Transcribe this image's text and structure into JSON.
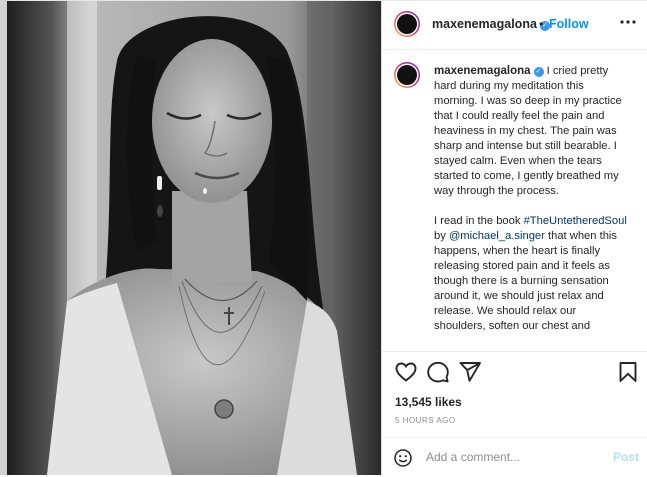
{
  "post": {
    "username": "maxenemagalona",
    "separator": "•",
    "follow_label": "Follow",
    "more_icon": "more-horizontal-icon",
    "verified_icon": "verified-badge-icon",
    "verified_glyph": "✓",
    "image_alt": "Black and white photo of a woman with eyes closed and a tear on her cheek"
  },
  "caption": {
    "username": "maxenemagalona",
    "p1": " I cried pretty hard during my meditation this morning. I was so deep in my practice that I could really feel the pain and heaviness in my chest. The pain was sharp and intense but still bearable. I stayed calm. Even when the tears started to come, I gently breathed my way through the process.",
    "p2_start": "I read in the book ",
    "hashtag": "#TheUntetheredSoul",
    "p2_mid": " by ",
    "mention": "@michael_a.singer",
    "p2_end": " that when this happens, when the heart is finally releasing stored pain and it feels as though there is a burning sensation around it, we should just relax and release. We should relax our shoulders, soften our chest and"
  },
  "actions": {
    "like_icon": "heart-icon",
    "comment_icon": "comment-icon",
    "share_icon": "share-icon",
    "save_icon": "bookmark-icon",
    "likes_text": "13,545 likes",
    "timestamp": "5 HOURS AGO"
  },
  "comment": {
    "emoji_icon": "emoji-icon",
    "placeholder": "Add a comment...",
    "post_label": "Post"
  },
  "colors": {
    "follow": "#0095f6",
    "verified": "#3897f0",
    "post_disabled": "#b2dffc"
  }
}
